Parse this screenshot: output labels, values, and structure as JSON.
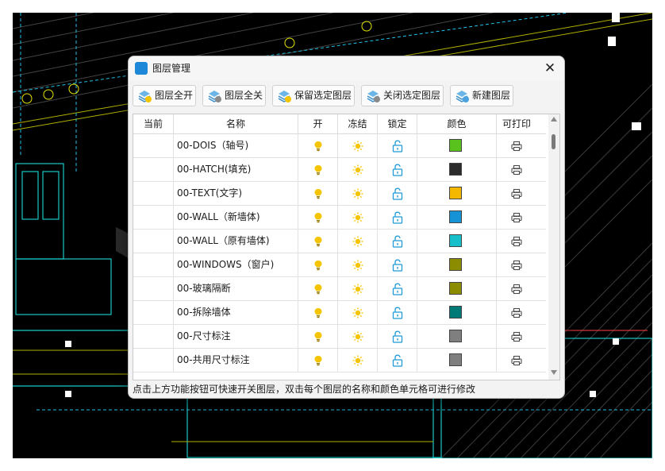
{
  "window": {
    "title": "图层管理",
    "close_glyph": "✕",
    "status_text": "点击上方功能按钮可快速开关图层，双击每个图层的名称和颜色单元格可进行修改"
  },
  "toolbar": {
    "all_on": "图层全开",
    "all_off": "图层全关",
    "keep_selected": "保留选定图层",
    "close_selected": "关闭选定图层",
    "new_layer": "新建图层"
  },
  "table": {
    "headers": [
      "当前",
      "名称",
      "开",
      "冻结",
      "锁定",
      "颜色",
      "可打印"
    ],
    "rows": [
      {
        "name": "00-DOIS（轴号)",
        "color": "#5ac21d"
      },
      {
        "name": "00-HATCH(填充)",
        "color": "#2b2b2b"
      },
      {
        "name": "00-TEXT(文字)",
        "color": "#f5b800"
      },
      {
        "name": "00-WALL（新墙体)",
        "color": "#1593d6"
      },
      {
        "name": "00-WALL（原有墙体)",
        "color": "#16bfc9"
      },
      {
        "name": "00-WINDOWS（窗户)",
        "color": "#8c8c00"
      },
      {
        "name": "00-玻璃隔断",
        "color": "#8c8c00"
      },
      {
        "name": "00-拆除墙体",
        "color": "#007a77"
      },
      {
        "name": "00-尺寸标注",
        "color": "#7f7f7f"
      },
      {
        "name": "00-共用尺寸标注",
        "color": "#7f7f7f"
      }
    ]
  },
  "icons": {
    "on": "lightbulb-icon",
    "freeze": "sun-icon",
    "lock": "unlock-icon",
    "print": "printer-icon"
  },
  "colors": {
    "bulb": "#f4c400",
    "sun": "#f4c400",
    "lock": "#1f9ad6",
    "printer": "#4a4a4a",
    "cad_background": "#000000"
  }
}
